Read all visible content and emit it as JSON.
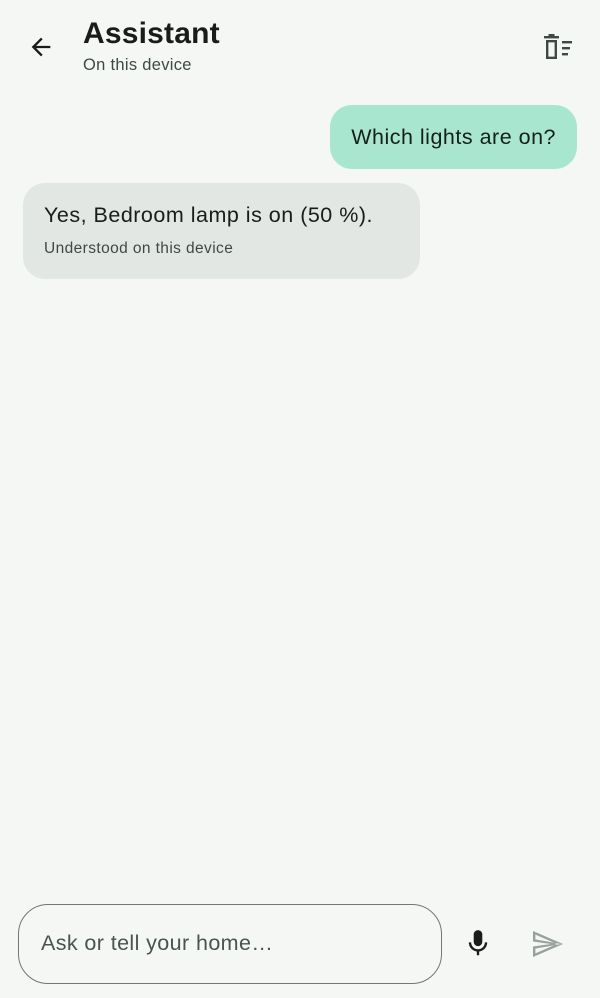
{
  "header": {
    "back_icon": "arrow-back-icon",
    "title": "Assistant",
    "subtitle": "On this device",
    "clear_icon": "clear-all-icon"
  },
  "conversation": {
    "messages": [
      {
        "role": "user",
        "text": "Which lights are on?"
      },
      {
        "role": "assistant",
        "text": "Yes, Bedroom lamp is on (50 %).",
        "meta": "Understood on this device"
      }
    ]
  },
  "composer": {
    "placeholder": "Ask or tell your home…",
    "value": "",
    "mic_icon": "microphone-icon",
    "send_icon": "send-icon"
  },
  "colors": {
    "background": "#f4f7f4",
    "user_bubble": "#a9e6d0",
    "assistant_bubble": "#e2e7e3",
    "outline": "#6f7973",
    "send_disabled": "#9aa19d"
  }
}
